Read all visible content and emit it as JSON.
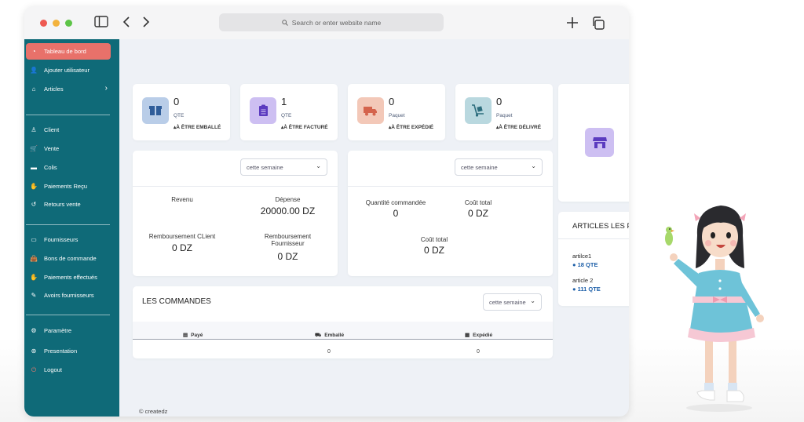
{
  "browser": {
    "url_placeholder": "Search or enter website name",
    "icons": [
      "sidebar-toggle-icon",
      "back-icon",
      "forward-icon",
      "new-tab-icon",
      "tabs-overview-icon"
    ]
  },
  "sidebar": {
    "groups": [
      [
        {
          "label": "Tableau de bord",
          "icon": "dashboard-icon",
          "active": true
        },
        {
          "label": "Ajouter utilisateur",
          "icon": "add-user-icon"
        },
        {
          "label": "Articles",
          "icon": "basket-icon",
          "has_submenu": true
        }
      ],
      [
        {
          "label": "Client",
          "icon": "user-icon"
        },
        {
          "label": "Vente",
          "icon": "cart-icon"
        },
        {
          "label": "Colis",
          "icon": "parcel-icon"
        },
        {
          "label": "Paiements Reçu",
          "icon": "payment-received-icon"
        },
        {
          "label": "Retours vente",
          "icon": "return-icon"
        }
      ],
      [
        {
          "label": "Fournisseurs",
          "icon": "supplier-icon"
        },
        {
          "label": "Bons de commande",
          "icon": "bag-icon"
        },
        {
          "label": "Paiements effectués",
          "icon": "payment-made-icon"
        },
        {
          "label": "Avoirs fournisseurs",
          "icon": "credit-note-icon"
        }
      ],
      [
        {
          "label": "Paramètre",
          "icon": "gear-icon"
        },
        {
          "label": "Presentation",
          "icon": "presentation-icon"
        },
        {
          "label": "Logout",
          "icon": "logout-icon"
        }
      ]
    ]
  },
  "stats": [
    {
      "value": "0",
      "unit": "QTE",
      "label": "À ÊTRE EMBALLÉ",
      "icon": "box-icon",
      "color": "#b9cde8",
      "icon_color": "#2f5d9a"
    },
    {
      "value": "1",
      "unit": "QTE",
      "label": "À ÊTRE FACTURÉ",
      "icon": "clipboard-icon",
      "color": "#cdbff2",
      "icon_color": "#5b3bbf"
    },
    {
      "value": "0",
      "unit": "Paquet",
      "label": "À ÊTRE EXPÉDIÉ",
      "icon": "truck-icon",
      "color": "#f3c8b8",
      "icon_color": "#d4634c"
    },
    {
      "value": "0",
      "unit": "Paquet",
      "label": "À ÊTRE DÉLIVRÉ",
      "icon": "dolly-icon",
      "color": "#b9d8df",
      "icon_color": "#2c6d7d"
    }
  ],
  "store_icon": {
    "icon": "store-icon",
    "color": "#cdbff2"
  },
  "finance": {
    "period": "cette semaine",
    "revenue_label": "Revenu",
    "expense_label": "Dépense",
    "expense_value": "20000.00 DZ",
    "client_refund_label": "Remboursement CLient",
    "client_refund_value": "0 DZ",
    "supplier_refund_label_1": "Remboursement",
    "supplier_refund_label_2": "Fournisseur",
    "supplier_refund_value": "0 DZ"
  },
  "orders_summary": {
    "period": "cette semaine",
    "qty_label": "Quantité commandée",
    "qty_value": "0",
    "cost_label": "Coût total",
    "cost_value": "0 DZ",
    "cost2_label": "Coût total",
    "cost2_value": "0 DZ"
  },
  "orders": {
    "title": "LES COMMANDES",
    "period": "cette semaine",
    "columns": [
      "Payé",
      "Emballé",
      "Expédié"
    ],
    "values": [
      "",
      "0",
      "0"
    ]
  },
  "top_articles": {
    "title": "ARTICLES LES P",
    "items": [
      {
        "name": "artilce1",
        "qty": "● 18 QTE"
      },
      {
        "name": "article 2",
        "qty": "● 111 QTE"
      }
    ]
  },
  "footer": {
    "text": "© createdz"
  },
  "colors": {
    "sidebar": "#0f6a78",
    "active": "#e8716a",
    "link": "#1d5fa8"
  }
}
